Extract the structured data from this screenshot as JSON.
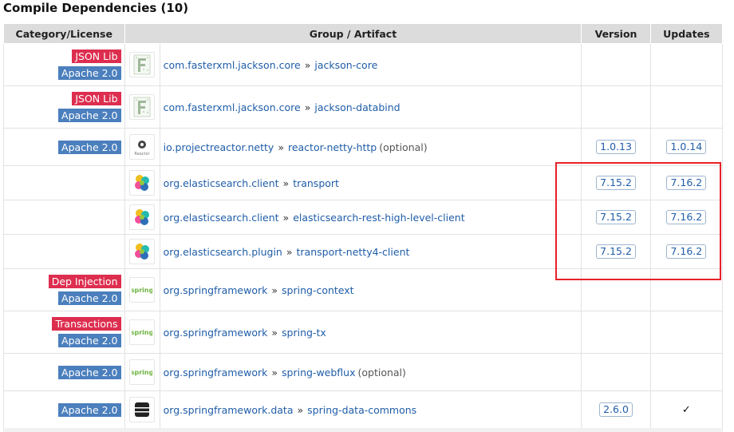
{
  "title": "Compile Dependencies (10)",
  "headers": {
    "category": "Category/License",
    "artifact": "Group / Artifact",
    "version": "Version",
    "updates": "Updates"
  },
  "separator": "»",
  "colors": {
    "tag_red": "#dd2e4f",
    "tag_blue": "#4b7fbd",
    "link": "#1f5da8",
    "highlight_box": "#e8202a"
  },
  "rows": [
    {
      "tags": [
        {
          "label": "JSON Lib",
          "color": "red"
        },
        {
          "label": "Apache 2.0",
          "color": "blue"
        }
      ],
      "logo": "jackson-logo",
      "group": "com.fasterxml.jackson.core",
      "artifact": "jackson-core",
      "optional": "",
      "version": "",
      "update": ""
    },
    {
      "tags": [
        {
          "label": "JSON Lib",
          "color": "red"
        },
        {
          "label": "Apache 2.0",
          "color": "blue"
        }
      ],
      "logo": "jackson-logo",
      "group": "com.fasterxml.jackson.core",
      "artifact": "jackson-databind",
      "optional": "",
      "version": "",
      "update": ""
    },
    {
      "tags": [
        {
          "label": "Apache 2.0",
          "color": "blue"
        }
      ],
      "logo": "reactor-logo",
      "logo_text": "Reactor",
      "group": "io.projectreactor.netty",
      "artifact": "reactor-netty-http",
      "optional": "(optional)",
      "version": "1.0.13",
      "update": "1.0.14"
    },
    {
      "tags": [],
      "logo": "elastic-logo",
      "group": "org.elasticsearch.client",
      "artifact": "transport",
      "optional": "",
      "version": "7.15.2",
      "update": "7.16.2"
    },
    {
      "tags": [],
      "logo": "elastic-logo",
      "group": "org.elasticsearch.client",
      "artifact": "elasticsearch-rest-high-level-client",
      "optional": "",
      "version": "7.15.2",
      "update": "7.16.2"
    },
    {
      "tags": [],
      "logo": "elastic-logo",
      "group": "org.elasticsearch.plugin",
      "artifact": "transport-netty4-client",
      "optional": "",
      "version": "7.15.2",
      "update": "7.16.2"
    },
    {
      "tags": [
        {
          "label": "Dep Injection",
          "color": "red"
        },
        {
          "label": "Apache 2.0",
          "color": "blue"
        }
      ],
      "logo": "spring-logo",
      "logo_text": "spring",
      "group": "org.springframework",
      "artifact": "spring-context",
      "optional": "",
      "version": "",
      "update": ""
    },
    {
      "tags": [
        {
          "label": "Transactions",
          "color": "red"
        },
        {
          "label": "Apache 2.0",
          "color": "blue"
        }
      ],
      "logo": "spring-logo",
      "logo_text": "spring",
      "group": "org.springframework",
      "artifact": "spring-tx",
      "optional": "",
      "version": "",
      "update": ""
    },
    {
      "tags": [
        {
          "label": "Apache 2.0",
          "color": "blue"
        }
      ],
      "logo": "spring-logo",
      "logo_text": "spring",
      "group": "org.springframework",
      "artifact": "spring-webflux",
      "optional": "(optional)",
      "version": "",
      "update": ""
    },
    {
      "tags": [
        {
          "label": "Apache 2.0",
          "color": "blue"
        }
      ],
      "logo": "database-logo",
      "group": "org.springframework.data",
      "artifact": "spring-data-commons",
      "optional": "",
      "version": "2.6.0",
      "update": "✓"
    }
  ]
}
